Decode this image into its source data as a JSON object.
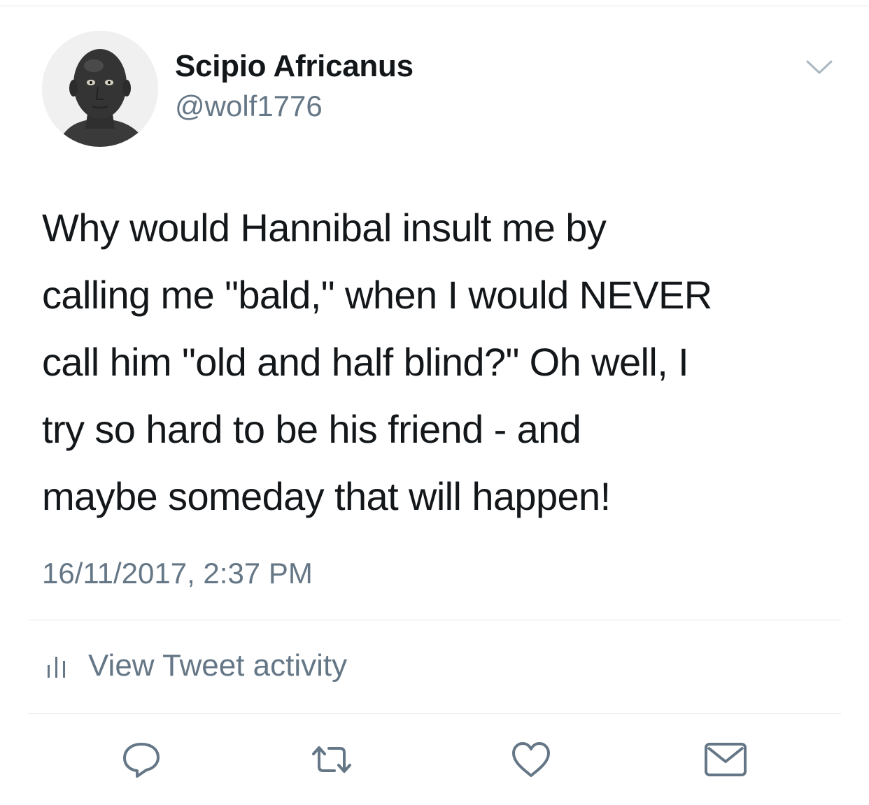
{
  "tweet": {
    "author": {
      "name": "Scipio Africanus",
      "handle": "@wolf1776",
      "avatar_icon": "bronze-bust-avatar"
    },
    "text_lines": [
      "Why would Hannibal insult me by",
      "calling me \"bald,\" when I would NEVER",
      "call him \"old and half blind?\" Oh well, I",
      "try so hard to be his friend - and",
      "maybe someday that will happen!"
    ],
    "timestamp": "16/11/2017, 2:37 PM",
    "activity_label": "View Tweet activity"
  },
  "icons": {
    "menu": "chevron-down-icon",
    "activity": "bar-chart-icon",
    "reply": "reply-icon",
    "retweet": "retweet-icon",
    "like": "heart-icon",
    "message": "envelope-icon"
  },
  "colors": {
    "text": "#14171a",
    "secondary": "#657786",
    "divider": "#e1e8ed"
  }
}
